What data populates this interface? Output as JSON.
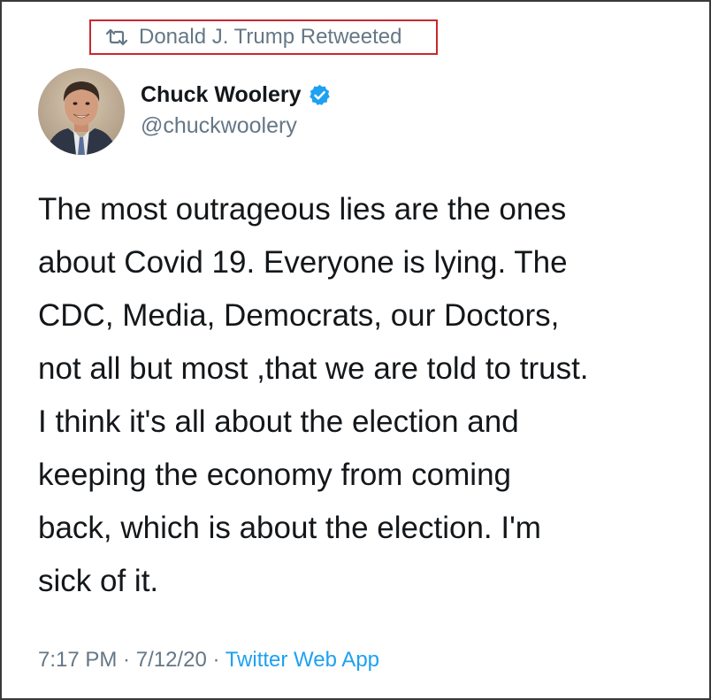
{
  "retweet": {
    "icon": "retweet-icon",
    "text": "Donald J. Trump Retweeted"
  },
  "author": {
    "display_name": "Chuck Woolery",
    "handle": "@chuckwoolery",
    "verified": true,
    "verified_icon": "verified-badge-icon",
    "verified_color": "#1da1f2"
  },
  "tweet": {
    "lines": [
      "The most outrageous lies are the ones",
      "about Covid 19. Everyone is lying. The",
      "CDC, Media, Democrats, our Doctors,",
      "not all but most ,that we are told to trust.",
      "I think it's all about the election and",
      "keeping the economy from coming",
      "back, which is about the election. I'm",
      "sick of it."
    ]
  },
  "meta": {
    "time": "7:17 PM",
    "sep1": " · ",
    "date": "7/12/20",
    "sep2": " · ",
    "source": "Twitter Web App"
  },
  "colors": {
    "text": "#14171a",
    "secondary": "#657786",
    "link": "#1da1f2",
    "highlight_border": "#c8282d"
  }
}
